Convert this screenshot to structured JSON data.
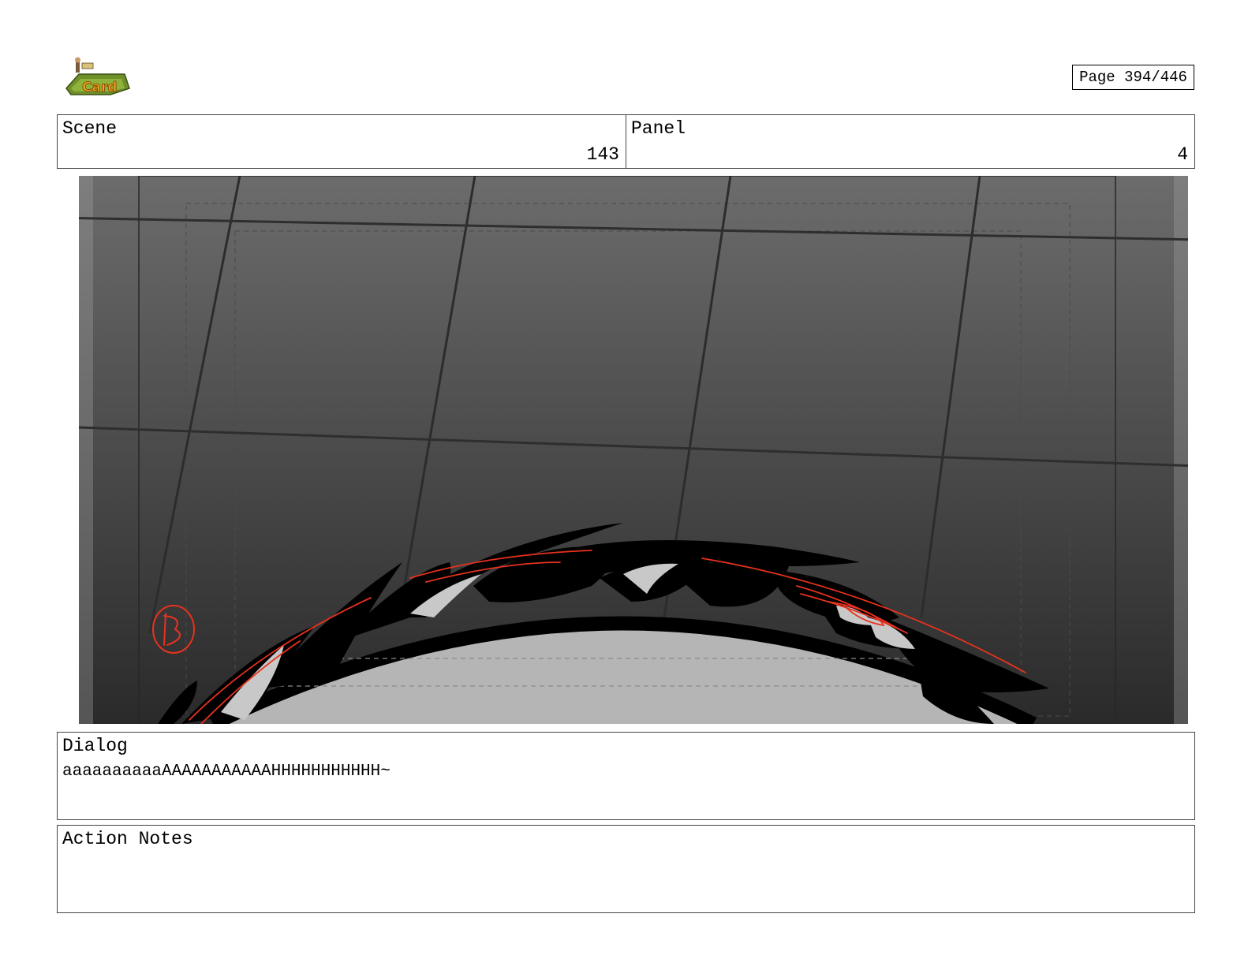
{
  "header": {
    "logo_icon": "studio-logo-icon",
    "page_label": "Page 394/446"
  },
  "scene": {
    "label": "Scene",
    "value": "143"
  },
  "panel": {
    "label": "Panel",
    "value": "4"
  },
  "dialog": {
    "label": "Dialog",
    "text": "aaaaaaaaaaAAAAAAAAAAAHHHHHHHHHHH~"
  },
  "action_notes": {
    "label": "Action Notes",
    "text": ""
  },
  "colors": {
    "sketch_red": "#e8321e",
    "frame_dark": "#2e2e2e",
    "frame_light": "#6a6a6a",
    "object_fill": "#b4b4b4"
  }
}
